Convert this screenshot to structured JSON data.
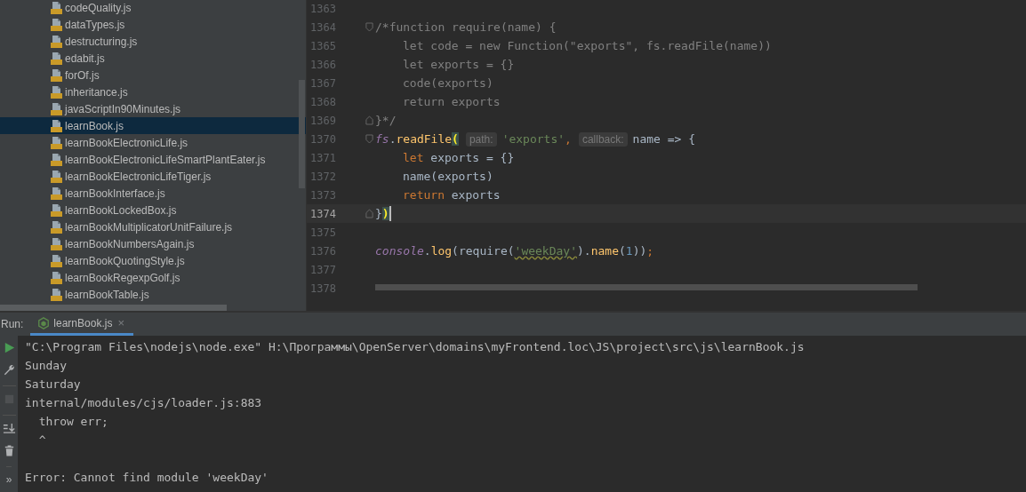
{
  "project_tree": {
    "items": [
      {
        "name": "codeQuality.js",
        "selected": false
      },
      {
        "name": "dataTypes.js",
        "selected": false
      },
      {
        "name": "destructuring.js",
        "selected": false
      },
      {
        "name": "edabit.js",
        "selected": false
      },
      {
        "name": "forOf.js",
        "selected": false
      },
      {
        "name": "inheritance.js",
        "selected": false
      },
      {
        "name": "javaScriptIn90Minutes.js",
        "selected": false
      },
      {
        "name": "learnBook.js",
        "selected": true
      },
      {
        "name": "learnBookElectronicLife.js",
        "selected": false
      },
      {
        "name": "learnBookElectronicLifeSmartPlantEater.js",
        "selected": false
      },
      {
        "name": "learnBookElectronicLifeTiger.js",
        "selected": false
      },
      {
        "name": "learnBookInterface.js",
        "selected": false
      },
      {
        "name": "learnBookLockedBox.js",
        "selected": false
      },
      {
        "name": "learnBookMultiplicatorUnitFailure.js",
        "selected": false
      },
      {
        "name": "learnBookNumbersAgain.js",
        "selected": false
      },
      {
        "name": "learnBookQuotingStyle.js",
        "selected": false
      },
      {
        "name": "learnBookRegexpGolf.js",
        "selected": false
      },
      {
        "name": "learnBookTable.js",
        "selected": false
      }
    ]
  },
  "editor": {
    "lines": [
      {
        "number": "1363",
        "current": false,
        "fold_open": false,
        "fold_close": false
      },
      {
        "number": "1364",
        "current": false,
        "fold_open": true,
        "fold_close": false,
        "segments": [
          {
            "text": "/*function require(name) {",
            "kind": "comment"
          }
        ]
      },
      {
        "number": "1365",
        "current": false,
        "fold_open": false,
        "fold_close": false,
        "indent": true,
        "segments": [
          {
            "text": "let code = new Function(\"exports\", fs.readFile(name))",
            "kind": "comment"
          }
        ]
      },
      {
        "number": "1366",
        "current": false,
        "fold_open": false,
        "fold_close": false,
        "indent": true,
        "segments": [
          {
            "text": "let exports = {}",
            "kind": "comment"
          }
        ]
      },
      {
        "number": "1367",
        "current": false,
        "fold_open": false,
        "fold_close": false,
        "indent": true,
        "segments": [
          {
            "text": "code(exports)",
            "kind": "comment"
          }
        ]
      },
      {
        "number": "1368",
        "current": false,
        "fold_open": false,
        "fold_close": false,
        "indent": true,
        "segments": [
          {
            "text": "return exports",
            "kind": "comment"
          }
        ]
      },
      {
        "number": "1369",
        "current": false,
        "fold_open": false,
        "fold_close": true,
        "segments": [
          {
            "text": "}*/",
            "kind": "comment"
          }
        ]
      },
      {
        "number": "1370",
        "current": false,
        "fold_open": true,
        "fold_close": false,
        "segments": [
          {
            "text": "fs",
            "kind": "object"
          },
          {
            "text": ".",
            "kind": "plain"
          },
          {
            "text": "readFile",
            "kind": "method"
          },
          {
            "text": "(",
            "kind": "brace"
          },
          {
            "text": "path:",
            "kind": "hint"
          },
          {
            "text": "'exports'",
            "kind": "string"
          },
          {
            "text": ",",
            "kind": "keyword"
          },
          {
            "text": "callback:",
            "kind": "hint"
          },
          {
            "text": "name => {",
            "kind": "plain"
          }
        ]
      },
      {
        "number": "1371",
        "current": false,
        "fold_open": false,
        "fold_close": false,
        "indent": true,
        "segments": [
          {
            "text": "let",
            "kind": "keyword"
          },
          {
            "text": " exports = {}",
            "kind": "plain"
          }
        ]
      },
      {
        "number": "1372",
        "current": false,
        "fold_open": false,
        "fold_close": false,
        "indent": true,
        "segments": [
          {
            "text": "name(exports)",
            "kind": "plain"
          }
        ]
      },
      {
        "number": "1373",
        "current": false,
        "fold_open": false,
        "fold_close": false,
        "indent": true,
        "segments": [
          {
            "text": "return",
            "kind": "keyword"
          },
          {
            "text": " exports",
            "kind": "plain"
          }
        ]
      },
      {
        "number": "1374",
        "current": true,
        "fold_open": false,
        "fold_close": true,
        "segments": [
          {
            "text": "}",
            "kind": "plain"
          },
          {
            "text": ")",
            "kind": "brace"
          }
        ]
      },
      {
        "number": "1375",
        "current": false,
        "fold_open": false,
        "fold_close": false
      },
      {
        "number": "1376",
        "current": false,
        "fold_open": false,
        "fold_close": false,
        "segments": [
          {
            "text": "console",
            "kind": "object"
          },
          {
            "text": ".",
            "kind": "plain"
          },
          {
            "text": "log",
            "kind": "method"
          },
          {
            "text": "(require(",
            "kind": "plain"
          },
          {
            "text": "'weekDay'",
            "kind": "string-warning"
          },
          {
            "text": ").",
            "kind": "plain"
          },
          {
            "text": "name",
            "kind": "method"
          },
          {
            "text": "(",
            "kind": "plain"
          },
          {
            "text": "1",
            "kind": "number"
          },
          {
            "text": "))",
            "kind": "plain"
          },
          {
            "text": ";",
            "kind": "keyword"
          }
        ]
      },
      {
        "number": "1377",
        "current": false,
        "fold_open": false,
        "fold_close": false
      },
      {
        "number": "1378",
        "current": false,
        "fold_open": false,
        "fold_close": false
      }
    ]
  },
  "run_panel": {
    "label": "Run:",
    "tabs": [
      {
        "label": "learnBook.js",
        "selected": true,
        "close": "×"
      }
    ],
    "toolbar": [
      {
        "kind": "run"
      },
      {
        "kind": "wrench"
      },
      {
        "kind": "stop"
      },
      {
        "kind": "scroll-end"
      },
      {
        "kind": "trash"
      },
      {
        "kind": "more",
        "text": "»"
      }
    ],
    "console": [
      "\"C:\\Program Files\\nodejs\\node.exe\" H:\\Программы\\OpenServer\\domains\\myFrontend.loc\\JS\\project\\src\\js\\learnBook.js",
      "Sunday",
      "Saturday",
      "internal/modules/cjs/loader.js:883",
      "  throw err;",
      "  ^"
    ],
    "error_message": "Error: Cannot find module 'weekDay'"
  }
}
